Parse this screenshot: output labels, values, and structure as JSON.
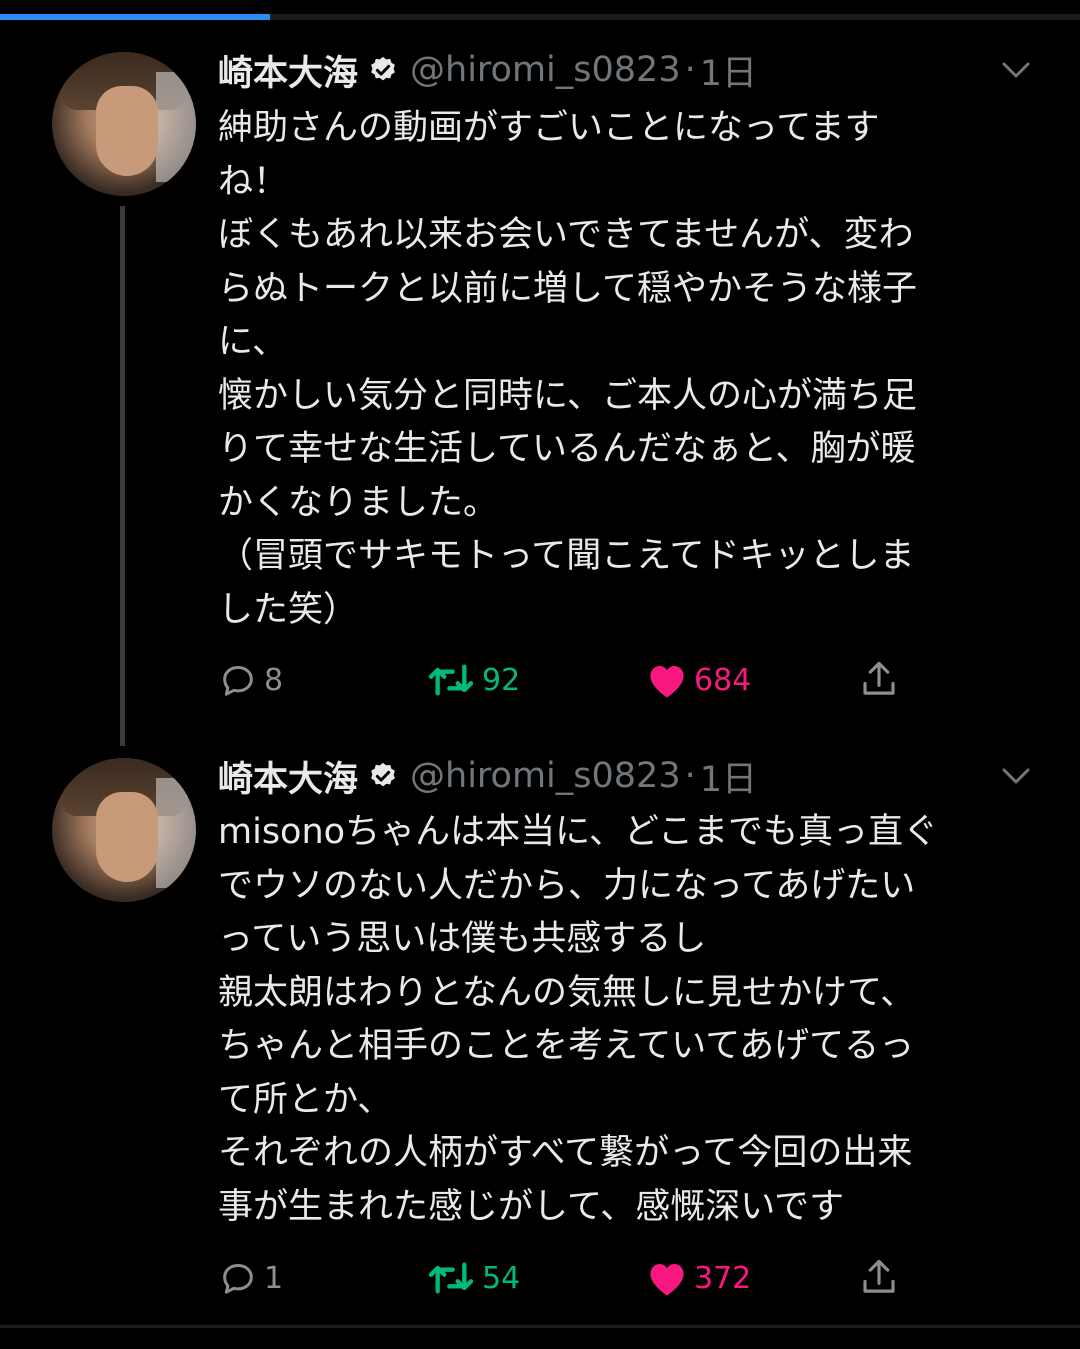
{
  "progress": 0.25,
  "colors": {
    "background": "#000000",
    "accent": "#2a8ff0",
    "retweet": "#00ba7c",
    "like": "#f91880",
    "muted": "#71767b"
  },
  "tweets": [
    {
      "name": "崎本大海",
      "handle": "@hiromi_s0823",
      "dot": "·",
      "time": "1日",
      "lines": [
        "紳助さんの動画がすごいことになってます",
        "ね！",
        "ぼくもあれ以来お会いできてませんが、変わ",
        "らぬトークと以前に増して穏やかそうな様子",
        "に、",
        "懐かしい気分と同時に、ご本人の心が満ち足",
        "りて幸せな生活しているんだなぁと、胸が暖",
        "かくなりました。",
        "（冒頭でサキモトって聞こえてドキッとしま",
        "した笑）"
      ],
      "replies": "8",
      "retweets": "92",
      "likes": "684",
      "icons": [
        "verified-icon",
        "chevron-down-icon",
        "reply-icon",
        "retweet-icon",
        "heart-icon",
        "share-icon"
      ]
    },
    {
      "name": "崎本大海",
      "handle": "@hiromi_s0823",
      "dot": "·",
      "time": "1日",
      "lines": [
        "misonoちゃんは本当に、どこまでも真っ直ぐ",
        "でウソのない人だから、力になってあげたい",
        "っていう思いは僕も共感するし",
        "親太朗はわりとなんの気無しに見せかけて、",
        "ちゃんと相手のことを考えていてあげてるっ",
        "て所とか、",
        "それぞれの人柄がすべて繋がって今回の出来",
        "事が生まれた感じがして、感慨深いです"
      ],
      "replies": "1",
      "retweets": "54",
      "likes": "372",
      "icons": [
        "verified-icon",
        "chevron-down-icon",
        "reply-icon",
        "retweet-icon",
        "heart-icon",
        "share-icon"
      ]
    }
  ]
}
